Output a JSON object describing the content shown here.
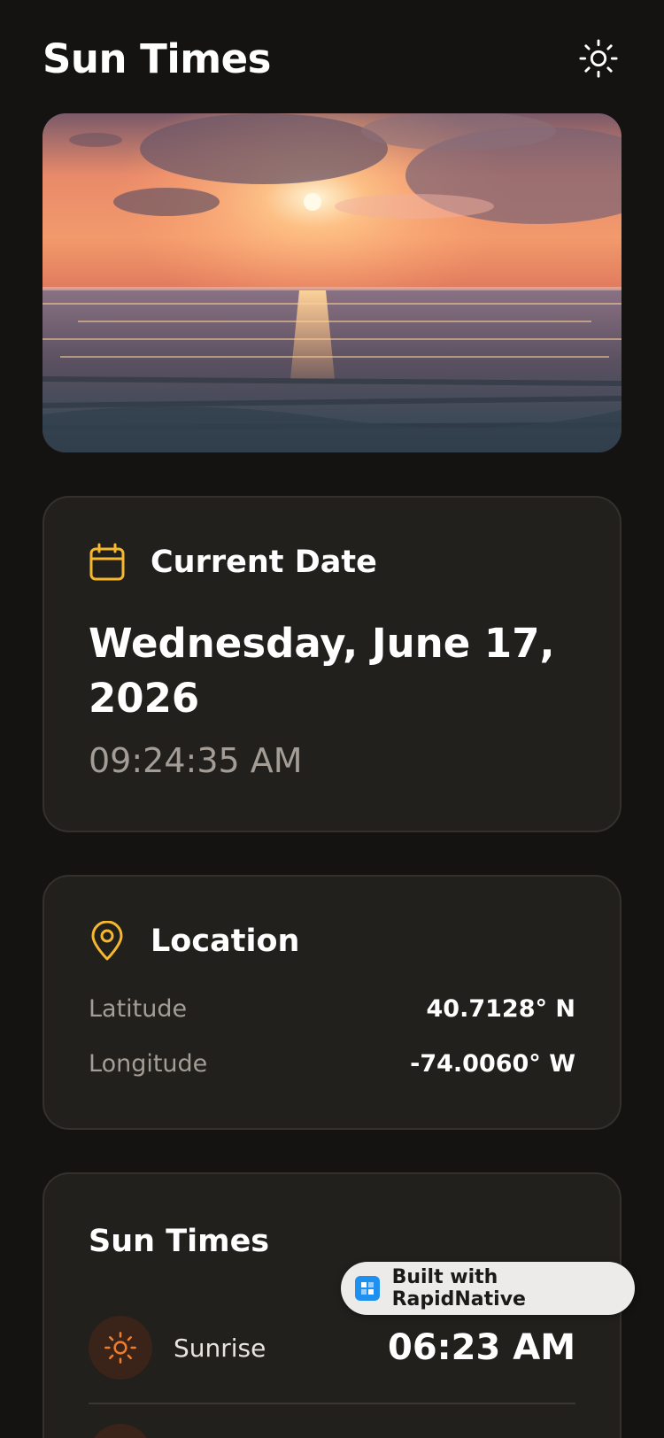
{
  "header": {
    "title": "Sun Times",
    "theme_icon": "sun-icon"
  },
  "hero": {
    "image": "sunset-over-ocean"
  },
  "current_date": {
    "icon": "calendar-icon",
    "title": "Current Date",
    "date": "Wednesday, June 17, 2026",
    "time": "09:24:35 AM"
  },
  "location": {
    "icon": "map-pin-icon",
    "title": "Location",
    "latitude_label": "Latitude",
    "latitude_value": "40.7128° N",
    "longitude_label": "Longitude",
    "longitude_value": "-74.0060° W"
  },
  "sun_times": {
    "title": "Sun Times",
    "rows": [
      {
        "icon": "sunrise-icon",
        "label": "Sunrise",
        "time": "06:23 AM"
      }
    ]
  },
  "badge": {
    "logo": "rapidnative-logo-icon",
    "text": "Built with RapidNative"
  },
  "colors": {
    "background": "#141311",
    "card": "#22201d",
    "accent_yellow": "#f5b82e",
    "accent_orange": "#f07d2a",
    "muted_text": "#a39d95"
  }
}
